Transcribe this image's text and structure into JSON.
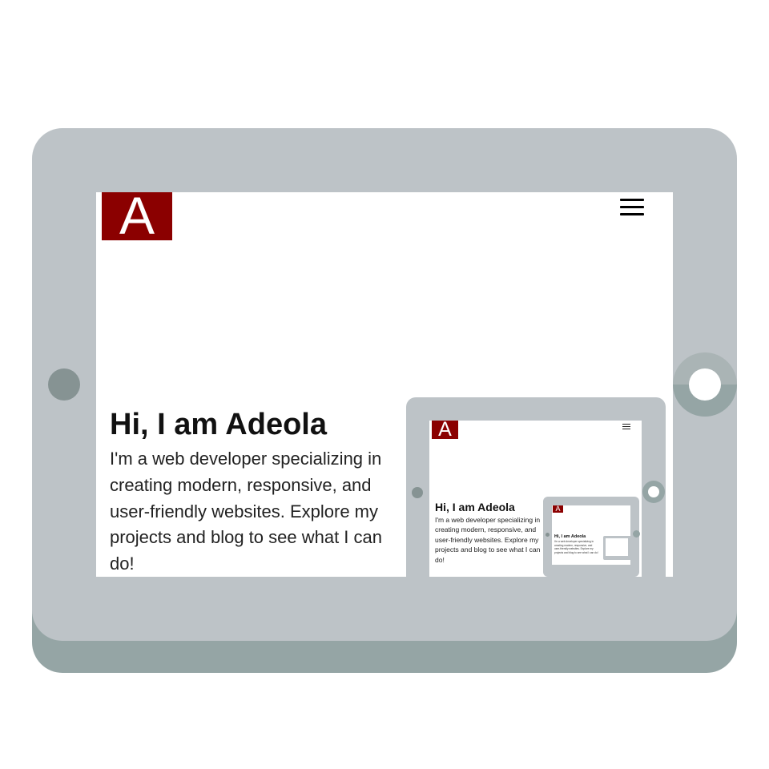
{
  "colors": {
    "tablet_body": "#bdc3c7",
    "tablet_shadow": "#95a5a5",
    "home_button": "#869393",
    "camera_top": "#aab4b5",
    "camera_bottom": "#95a5a5",
    "logo_red": "#8b0000",
    "text_dark": "#111111"
  },
  "logo": {
    "letter": "A",
    "icon": "logo-letter-a"
  },
  "menu": {
    "icon": "hamburger-menu-icon"
  },
  "hero": {
    "title": "Hi, I am Adeola",
    "text": "I'm a web developer specializing in creating modern, responsive, and user-friendly websites. Explore my projects and blog to see what I can do!"
  }
}
